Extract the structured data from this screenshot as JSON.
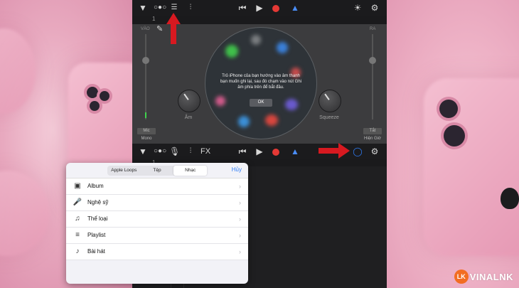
{
  "top_panel": {
    "left_label": "VÀO",
    "right_label": "RA",
    "knob_left_label": "Âm",
    "knob_right_label": "Squeeze",
    "left_btn_1": "Mic",
    "left_btn_2": "Mono",
    "right_btn_1": "Tắt",
    "right_btn_2": "Hiện Giờ",
    "overlay_message": "Trỏ iPhone của bạn hướng vào âm thanh bạn muốn ghi lại, sau đó chạm vào nút Ghi âm phía trên để bắt đầu.",
    "overlay_ok": "OK",
    "ruler_marker": "1",
    "toolbar_fx": ""
  },
  "bottom_toolbar": {
    "fx_label": "FX",
    "ruler_marker": "1"
  },
  "browser_sheet": {
    "tabs": [
      {
        "label": "Apple Loops"
      },
      {
        "label": "Tệp"
      },
      {
        "label": "Nhạc"
      }
    ],
    "active_tab": "Nhạc",
    "cancel_label": "Hủy",
    "items": [
      {
        "label": "Album",
        "icon": "album-icon"
      },
      {
        "label": "Nghệ sỹ",
        "icon": "microphone-icon"
      },
      {
        "label": "Thể loại",
        "icon": "genre-icon"
      },
      {
        "label": "Playlist",
        "icon": "playlist-icon"
      },
      {
        "label": "Bài hát",
        "icon": "music-note-icon"
      }
    ]
  },
  "watermark": {
    "badge": "LK",
    "text": "VINALNK"
  },
  "colors": {
    "accent_blue": "#2f7df6",
    "record_red": "#e53935",
    "arrow_red": "#d71920",
    "logo_orange": "#f26d21"
  }
}
